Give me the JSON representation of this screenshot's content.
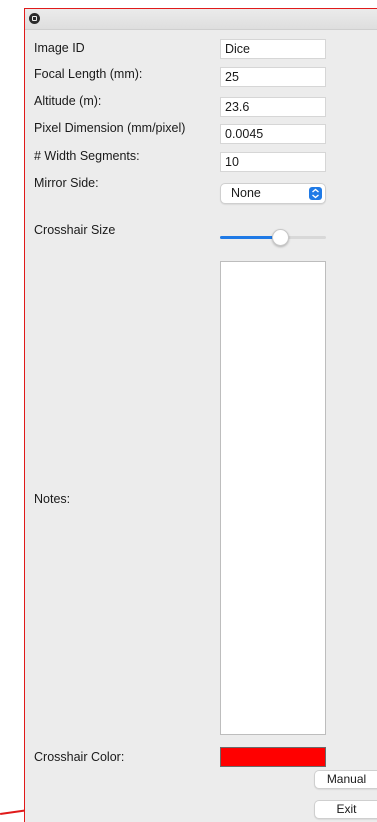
{
  "form": {
    "image_id": {
      "label": "Image ID",
      "value": "Dice"
    },
    "focal_length": {
      "label": "Focal Length (mm):",
      "value": "25"
    },
    "altitude": {
      "label": "Altitude (m):",
      "value": "23.6"
    },
    "pixel_dimension": {
      "label": "Pixel Dimension (mm/pixel)",
      "value": "0.0045"
    },
    "width_segments": {
      "label": "# Width Segments:",
      "value": "10"
    },
    "mirror_side": {
      "label": "Mirror Side:",
      "value": "None"
    },
    "crosshair_size": {
      "label": "Crosshair Size",
      "fraction": 0.57
    },
    "notes": {
      "label": "Notes:",
      "value": ""
    },
    "crosshair_color": {
      "label": "Crosshair Color:",
      "color": "#ff0000"
    }
  },
  "buttons": {
    "manual_label": "Manual",
    "exit_label": "Exit"
  },
  "colors": {
    "accent": "#1f7ae6",
    "highlight_outline": "#e01a1a"
  },
  "icons": {
    "window": "app-window-icon",
    "select": "chevron-up-down-icon"
  }
}
